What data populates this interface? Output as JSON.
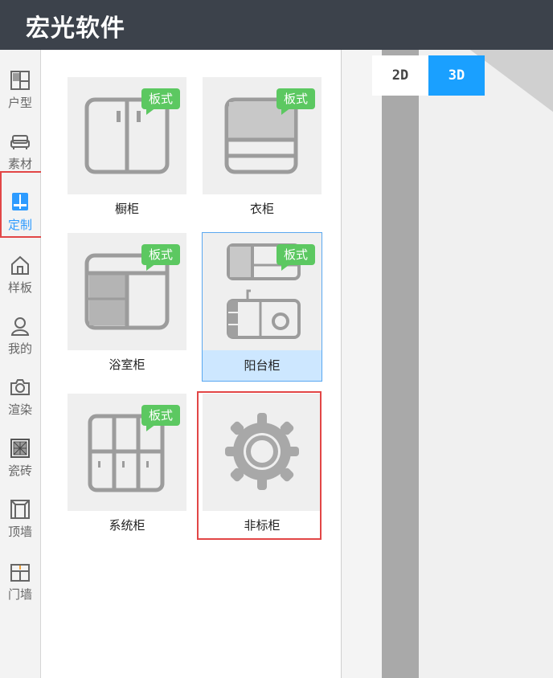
{
  "app": {
    "title": "宏光软件"
  },
  "sidebar": {
    "items": [
      {
        "label": "户型",
        "icon": "floorplan-icon"
      },
      {
        "label": "素材",
        "icon": "sofa-icon"
      },
      {
        "label": "定制",
        "icon": "cabinet-icon",
        "active": true
      },
      {
        "label": "样板",
        "icon": "house-icon"
      },
      {
        "label": "我的",
        "icon": "user-icon"
      },
      {
        "label": "渲染",
        "icon": "camera-icon"
      },
      {
        "label": "瓷砖",
        "icon": "tile-icon"
      },
      {
        "label": "顶墙",
        "icon": "ceiling-icon"
      },
      {
        "label": "门墙",
        "icon": "door-wall-icon"
      }
    ]
  },
  "catalog": {
    "badge_label": "板式",
    "items": [
      {
        "name": "橱柜",
        "badge": true
      },
      {
        "name": "衣柜",
        "badge": true
      },
      {
        "name": "浴室柜",
        "badge": true
      },
      {
        "name": "阳台柜",
        "badge": true,
        "selected": true
      },
      {
        "name": "系统柜",
        "badge": true
      },
      {
        "name": "非标柜",
        "badge": false
      }
    ]
  },
  "view_toggle": {
    "options": [
      "2D",
      "3D"
    ],
    "selected": "3D"
  },
  "colors": {
    "accent": "#1aa0ff",
    "titlebar": "#3c424b",
    "badge": "#5cc861",
    "highlight": "#e24646",
    "selected_bg": "#cde7ff"
  }
}
